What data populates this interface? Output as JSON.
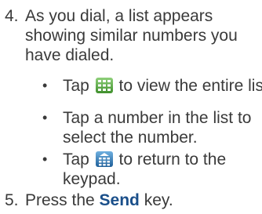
{
  "step4": {
    "number": "4.",
    "lines": [
      "As you dial, a list appears",
      "showing similar numbers you",
      "have dialed."
    ]
  },
  "bullets": [
    {
      "dot": "•",
      "before_icon": "Tap ",
      "icon": "list-grid-icon",
      "after_icon": " to view the entire list."
    },
    {
      "dot": "•",
      "lines": [
        "Tap a number in the list to",
        "select the number."
      ]
    },
    {
      "dot": "•",
      "before_icon": "Tap ",
      "icon": "keypad-icon",
      "after_icon": " to return to the",
      "line2": "keypad."
    }
  ],
  "step5": {
    "number": "5.",
    "before": "Press the ",
    "key": "Send",
    "after": " key."
  },
  "colors": {
    "text": "#3a3a3a",
    "key_name": "#1a4f8a",
    "icon_green": "#5aa843",
    "icon_blue": "#2a7bbd"
  }
}
